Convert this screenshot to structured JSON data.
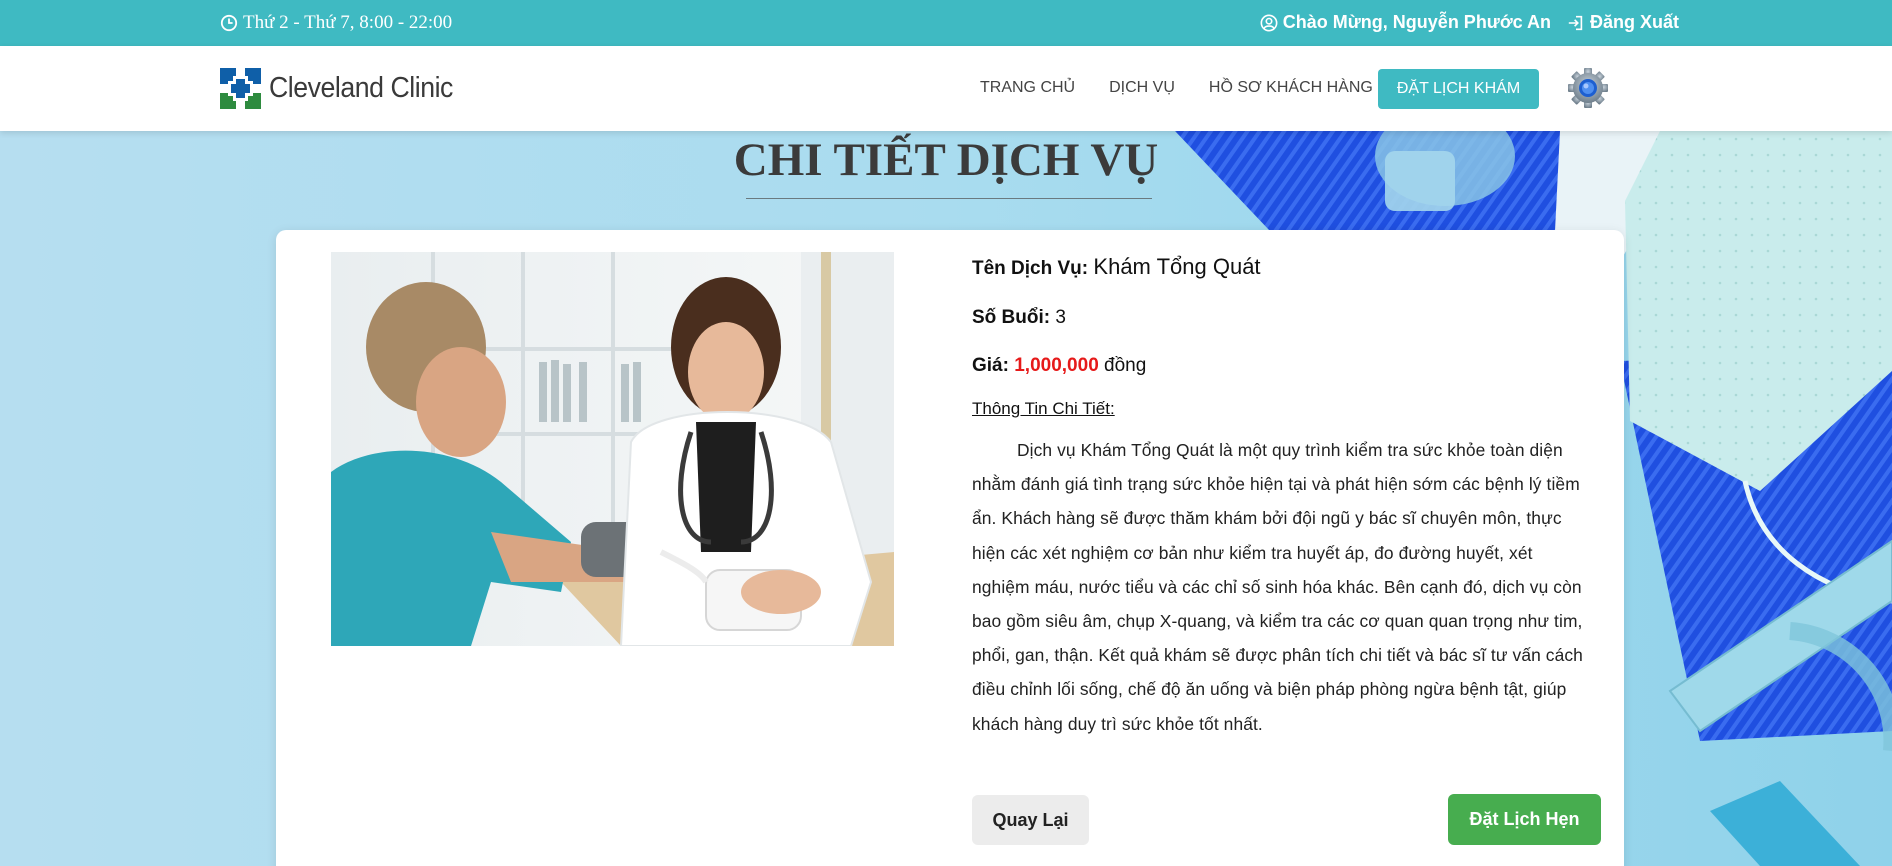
{
  "topbar": {
    "hours": "Thứ 2 - Thứ 7, 8:00 - 22:00",
    "greeting": "Chào Mừng, Nguyễn Phước An",
    "logout": "Đăng Xuất"
  },
  "header": {
    "logo_text": "Cleveland Clinic",
    "nav": {
      "home": "TRANG CHỦ",
      "services": "DỊCH VỤ",
      "profile": "HỒ SƠ KHÁCH HÀNG"
    },
    "book_button": "ĐẶT LỊCH KHÁM"
  },
  "page": {
    "title": "CHI TIẾT DỊCH VỤ"
  },
  "service": {
    "name_label": "Tên Dịch Vụ:",
    "name": "Khám Tổng Quát",
    "sessions_label": "Số Buổi:",
    "sessions": "3",
    "price_label": "Giá:",
    "price": "1,000,000",
    "price_unit": "đồng",
    "detail_label": "Thông Tin Chi Tiết:",
    "description": "Dịch vụ Khám Tổng Quát là một quy trình kiểm tra sức khỏe toàn diện nhằm đánh giá tình trạng sức khỏe hiện tại và phát hiện sớm các bệnh lý tiềm ẩn. Khách hàng sẽ được thăm khám bởi đội ngũ y bác sĩ chuyên môn, thực hiện các xét nghiệm cơ bản như kiểm tra huyết áp, đo đường huyết, xét nghiệm máu, nước tiểu và các chỉ số sinh hóa khác. Bên cạnh đó, dịch vụ còn bao gồm siêu âm, chụp X-quang, và kiểm tra các cơ quan quan trọng như tim, phổi, gan, thận. Kết quả khám sẽ được phân tích chi tiết và bác sĩ tư vấn cách điều chỉnh lối sống, chế độ ăn uống và biện pháp phòng ngừa bệnh tật, giúp khách hàng duy trì sức khỏe tốt nhất."
  },
  "actions": {
    "back": "Quay Lại",
    "book": "Đặt Lịch Hẹn"
  },
  "colors": {
    "brand_teal": "#3fbac2",
    "price_red": "#e61a1a",
    "book_green": "#47ad4f"
  }
}
